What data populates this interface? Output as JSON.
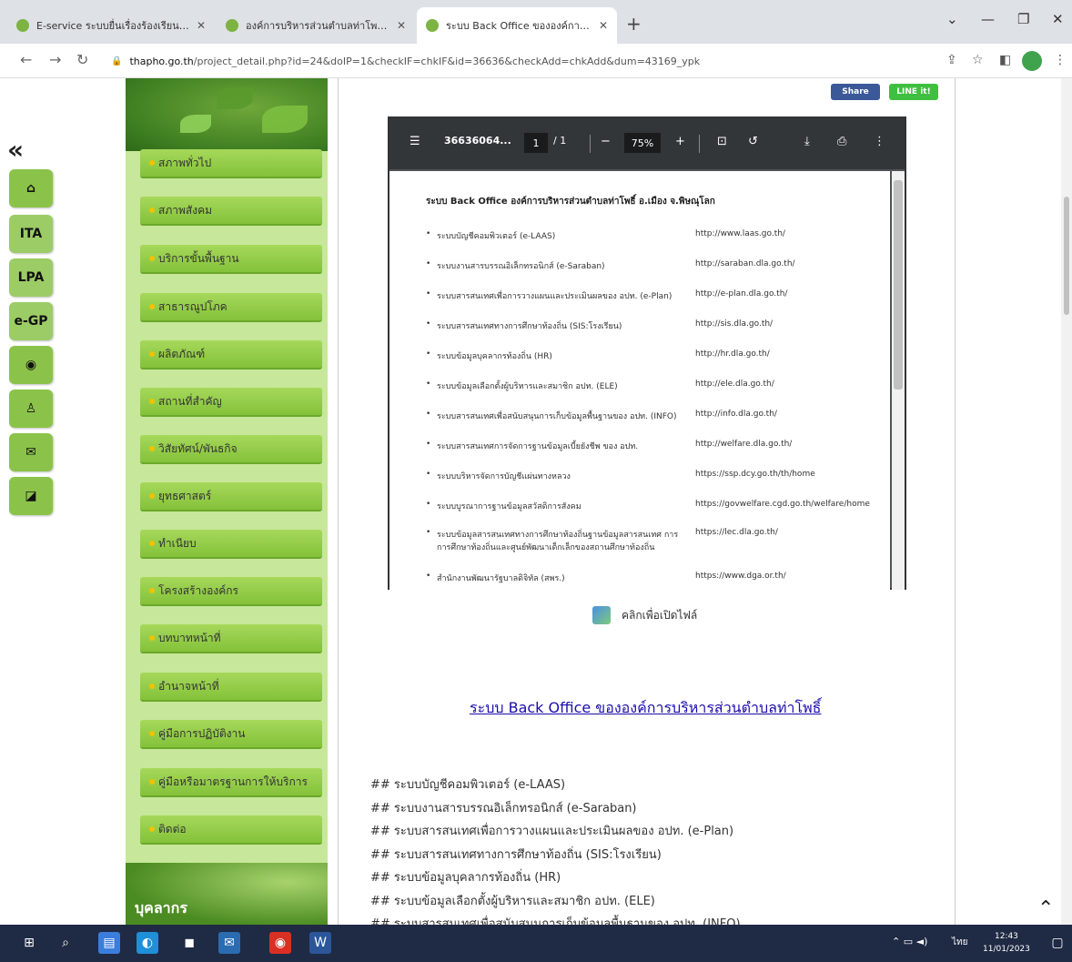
{
  "browser": {
    "tabs": [
      {
        "title": "E-service ระบบยื่นเรื่องร้องเรียนออนไลน์",
        "active": false,
        "color": "#7cb342"
      },
      {
        "title": "องค์การบริหารส่วนตำบลท่าโพธิ์ อ.เมือง",
        "active": false,
        "color": "#7cb342"
      },
      {
        "title": "ระบบ Back Office ขององค์การบริหาร",
        "active": true,
        "color": "#7cb342"
      }
    ],
    "new_tab": "+",
    "url_host": "thapho.go.th",
    "url_path": "/project_detail.php?id=24&doIP=1&checkIF=chkIF&id=36636&checkAdd=chkAdd&dum=43169_ypk"
  },
  "sidebar_tabs": [
    "ITA",
    "LPA",
    "e-GP"
  ],
  "menu": [
    "สภาพทั่วไป",
    "สภาพสังคม",
    "บริการขั้นพื้นฐาน",
    "สาธารณูปโภค",
    "ผลิตภัณฑ์",
    "สถานที่สำคัญ",
    "วิสัยทัศน์/พันธกิจ",
    "ยุทธศาสตร์",
    "ทำเนียบ",
    "โครงสร้างองค์กร",
    "บทบาทหน้าที่",
    "อำนาจหน้าที่",
    "คู่มือการปฏิบัติงาน",
    "คู่มือหรือมาตรฐานการให้บริการ",
    "ติดต่อ"
  ],
  "personnel_label": "บุคลากร",
  "share": {
    "facebook": "Share",
    "line": "LINE it!"
  },
  "pdf": {
    "filename": "36636064...",
    "page_current": "1",
    "page_total": "/ 1",
    "zoom": "75%",
    "heading": "ระบบ Back Office องค์การบริหารส่วนตำบลท่าโพธิ์ อ.เมือง จ.พิษณุโลก",
    "rows": [
      {
        "name": "ระบบบัญชีคอมพิวเตอร์ (e-LAAS)",
        "url": "http://www.laas.go.th/"
      },
      {
        "name": "ระบบงานสารบรรณอิเล็กทรอนิกส์ (e-Saraban)",
        "url": "http://saraban.dla.go.th/"
      },
      {
        "name": "ระบบสารสนเทศเพื่อการวางแผนและประเมินผลของ อปท. (e-Plan)",
        "url": "http://e-plan.dla.go.th/"
      },
      {
        "name": "ระบบสารสนเทศทางการศึกษาท้องถิ่น (SIS:โรงเรียน)",
        "url": "http://sis.dla.go.th/"
      },
      {
        "name": "ระบบข้อมูลบุคลากรท้องถิ่น (HR)",
        "url": "http://hr.dla.go.th/"
      },
      {
        "name": "ระบบข้อมูลเลือกตั้งผู้บริหารและสมาชิก อปท. (ELE)",
        "url": "http://ele.dla.go.th/"
      },
      {
        "name": "ระบบสารสนเทศเพื่อสนับสนุนการเก็บข้อมูลพื้นฐานของ อปท. (INFO)",
        "url": "http://info.dla.go.th/"
      },
      {
        "name": "ระบบสารสนเทศการจัดการฐานข้อมูลเบี้ยยังชีพ ของ อปท.",
        "url": "http://welfare.dla.go.th/"
      },
      {
        "name": "ระบบบริหารจัดการบัญชีแผ่นทางหลวง",
        "url": "https://ssp.dcy.go.th/th/home"
      },
      {
        "name": "ระบบบูรณาการฐานข้อมูลสวัสดิการสังคม",
        "url": "https://govwelfare.cgd.go.th/welfare/home"
      },
      {
        "name": "ระบบข้อมูลสารสนเทศทางการศึกษาท้องถิ่นฐานข้อมูลสารสนเทศ การการศึกษาท้องถิ่นและศูนย์พัฒนาเด็กเล็กของสถานศึกษาท้องถิ่น",
        "url": "https://lec.dla.go.th/"
      },
      {
        "name": "สำนักงานพัฒนารัฐบาลดิจิทัล (สพร.)",
        "url": "https://www.dga.or.th/"
      }
    ]
  },
  "open_file_label": "คลิกเพื่อเปิดไฟล์",
  "backoffice_link": "ระบบ Back Office ขององค์การบริหารส่วนตำบลท่าโพธิ์",
  "system_list": [
    "## ระบบบัญชีคอมพิวเตอร์ (e-LAAS)",
    "## ระบบงานสารบรรณอิเล็กทรอนิกส์ (e-Saraban)",
    "## ระบบสารสนเทศเพื่อการวางแผนและประเมินผลของ อปท. (e-Plan)",
    "## ระบบสารสนเทศทางการศึกษาท้องถิ่น (SIS:โรงเรียน)",
    "## ระบบข้อมูลบุคลากรท้องถิ่น (HR)",
    "## ระบบข้อมูลเลือกตั้งผู้บริหารและสมาชิก อปท. (ELE)",
    "## ระบบสารสนเทศเพื่อสนับสนุนการเก็บข้อมูลพื้นฐานของ อปท. (INFO)"
  ],
  "taskbar": {
    "time": "12:43",
    "date": "11/01/2023",
    "lang": "ไทย"
  }
}
